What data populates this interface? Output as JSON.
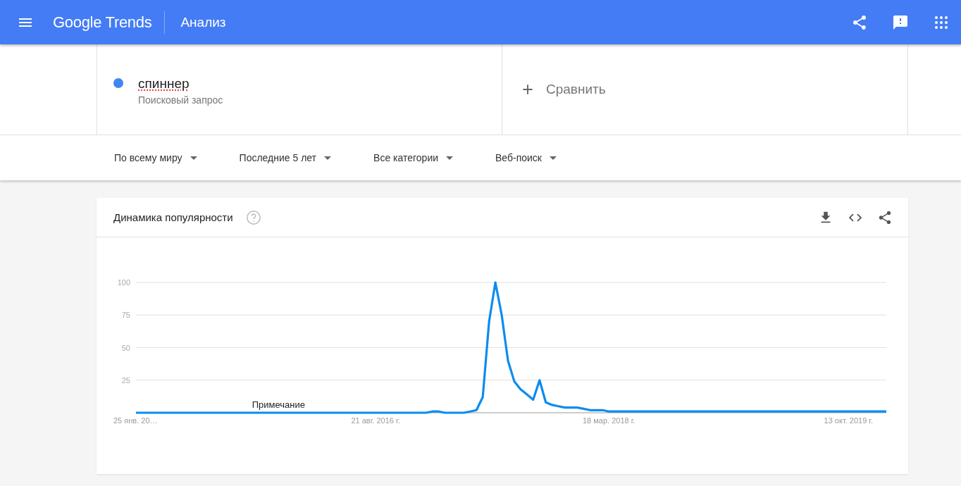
{
  "header": {
    "logo": "Google Trends",
    "section": "Анализ"
  },
  "search": {
    "term": {
      "text": "спиннер",
      "subtitle": "Поисковый запрос",
      "color": "#4285f4"
    },
    "compare": {
      "label": "Сравнить"
    }
  },
  "filters": [
    {
      "label": "По всему миру"
    },
    {
      "label": "Последние 5 лет"
    },
    {
      "label": "Все категории"
    },
    {
      "label": "Веб-поиск"
    }
  ],
  "interest_card": {
    "title": "Динамика популярности",
    "chart_data": {
      "type": "line",
      "grid": true,
      "ylim": [
        0,
        100
      ],
      "yticks": [
        25,
        50,
        75,
        100
      ],
      "categories": [
        "25 янв. 20…",
        null,
        null,
        null,
        null,
        null,
        null,
        null,
        null,
        null,
        null,
        null,
        null,
        null,
        null,
        null,
        null,
        null,
        null,
        null,
        null,
        null,
        null,
        null,
        null,
        null,
        null,
        null,
        null,
        null,
        null,
        null,
        null,
        null,
        null,
        null,
        null,
        null,
        "21 авг. 2016 г.",
        null,
        null,
        null,
        null,
        null,
        null,
        null,
        null,
        null,
        null,
        null,
        null,
        null,
        null,
        null,
        null,
        null,
        null,
        null,
        null,
        null,
        null,
        null,
        null,
        null,
        null,
        null,
        null,
        null,
        null,
        null,
        null,
        null,
        null,
        null,
        null,
        "18 мар. 2018 г.",
        null,
        null,
        null,
        null,
        null,
        null,
        null,
        null,
        null,
        null,
        null,
        null,
        null,
        null,
        null,
        null,
        null,
        null,
        null,
        null,
        null,
        null,
        null,
        null,
        null,
        null,
        null,
        null,
        null,
        null,
        null,
        null,
        null,
        null,
        null,
        null,
        null,
        "13 окт. 2019 г.",
        null,
        null,
        null,
        null,
        null,
        null
      ],
      "series": [
        {
          "color": "#0b8cf0",
          "values": [
            0,
            0,
            0,
            0,
            0,
            0,
            0,
            0,
            0,
            0,
            0,
            0,
            0,
            0,
            0,
            0,
            0,
            0,
            0,
            0,
            0,
            0,
            0,
            0,
            0,
            0,
            0,
            0,
            0,
            0,
            0,
            0,
            0,
            0,
            0,
            0,
            0,
            0,
            0,
            0,
            0,
            0,
            0,
            0,
            0,
            0,
            0,
            1,
            1,
            0,
            0,
            0,
            0,
            1,
            2,
            12,
            70,
            100,
            75,
            40,
            24,
            18,
            14,
            10,
            25,
            8,
            6,
            5,
            4,
            4,
            4,
            3,
            2,
            2,
            2,
            1,
            1,
            1,
            1,
            1,
            1,
            1,
            1,
            1,
            1,
            1,
            1,
            1,
            1,
            1,
            1,
            1,
            1,
            1,
            1,
            1,
            1,
            1,
            1,
            1,
            1,
            1,
            1,
            1,
            1,
            1,
            1,
            1,
            1,
            1,
            1,
            1,
            1,
            1,
            1,
            1,
            1,
            1,
            1,
            1
          ]
        }
      ],
      "annotations": [
        {
          "text": "Примечание"
        }
      ]
    }
  }
}
